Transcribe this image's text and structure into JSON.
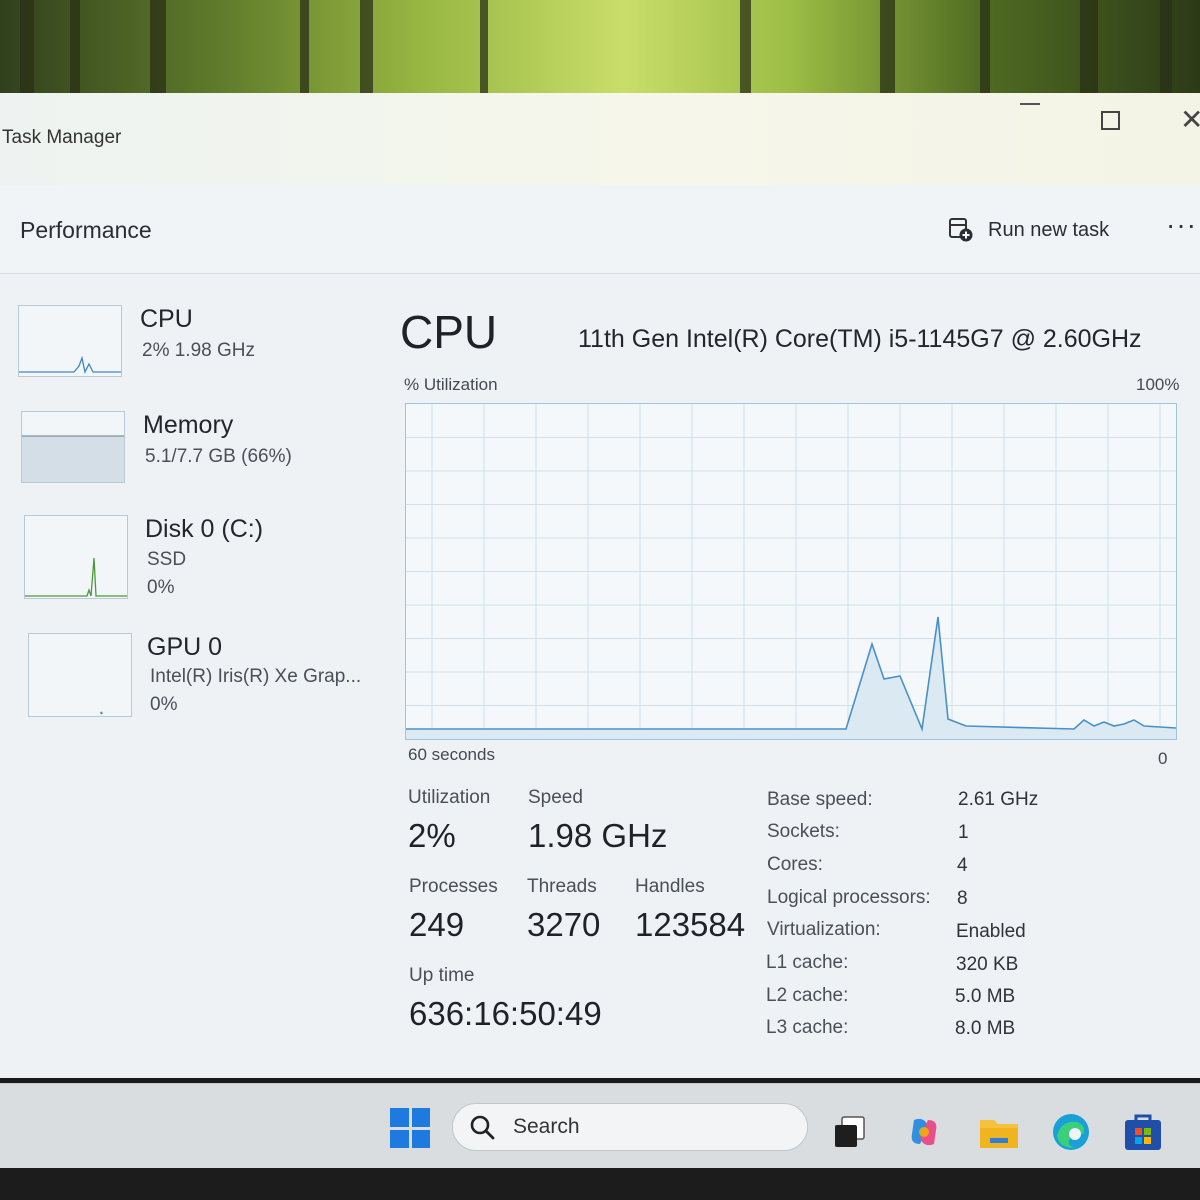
{
  "window": {
    "title": "Task Manager"
  },
  "header": {
    "page_title": "Performance",
    "run_new_task": "Run new task",
    "more": "···"
  },
  "sidebar": {
    "items": [
      {
        "name": "CPU",
        "sub1": "2%  1.98 GHz",
        "sub2": ""
      },
      {
        "name": "Memory",
        "sub1": "5.1/7.7 GB (66%)",
        "sub2": ""
      },
      {
        "name": "Disk 0 (C:)",
        "sub1": "SSD",
        "sub2": "0%"
      },
      {
        "name": "GPU 0",
        "sub1": "Intel(R) Iris(R) Xe Grap...",
        "sub2": "0%"
      }
    ]
  },
  "main": {
    "title": "CPU",
    "model": "11th Gen Intel(R) Core(TM) i5-1145G7 @ 2.60GHz",
    "util_label": "% Utilization",
    "util_max": "100%",
    "axis_left": "60 seconds",
    "axis_right": "0"
  },
  "stats": {
    "utilization": {
      "label": "Utilization",
      "value": "2%"
    },
    "speed": {
      "label": "Speed",
      "value": "1.98 GHz"
    },
    "processes": {
      "label": "Processes",
      "value": "249"
    },
    "threads": {
      "label": "Threads",
      "value": "3270"
    },
    "handles": {
      "label": "Handles",
      "value": "123584"
    },
    "uptime": {
      "label": "Up time",
      "value": "636:16:50:49"
    }
  },
  "specs": [
    {
      "label": "Base speed:",
      "value": "2.61 GHz"
    },
    {
      "label": "Sockets:",
      "value": "1"
    },
    {
      "label": "Cores:",
      "value": "4"
    },
    {
      "label": "Logical processors:",
      "value": "8"
    },
    {
      "label": "Virtualization:",
      "value": "Enabled"
    },
    {
      "label": "L1 cache:",
      "value": "320 KB"
    },
    {
      "label": "L2 cache:",
      "value": "5.0 MB"
    },
    {
      "label": "L3 cache:",
      "value": "8.0 MB"
    }
  ],
  "taskbar": {
    "search_placeholder": "Search"
  },
  "colors": {
    "graph_line": "#4a90c8",
    "graph_fill": "#dbe9f3",
    "grid": "#cfe0ec",
    "accent": "#1f7ae0"
  },
  "icons": [
    "minimize-icon",
    "maximize-icon",
    "close-icon",
    "run-task-icon",
    "more-icon",
    "windows-start-icon",
    "search-icon",
    "task-view-icon",
    "copilot-icon",
    "file-explorer-icon",
    "edge-icon",
    "store-icon"
  ]
}
